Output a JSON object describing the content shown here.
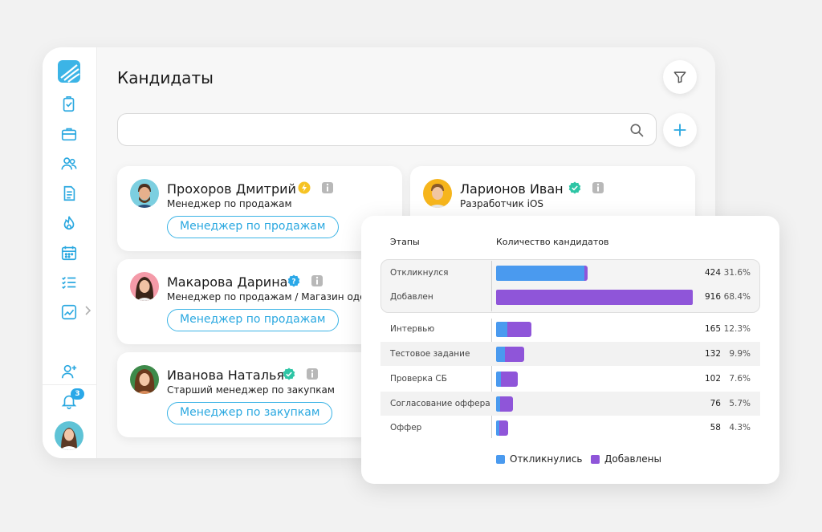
{
  "page": {
    "title": "Кандидаты"
  },
  "search": {
    "value": "",
    "placeholder": ""
  },
  "sidebar": {
    "nav": [
      "logo-icon",
      "tasks-icon",
      "briefcase-icon",
      "users-icon",
      "document-icon",
      "fire-icon",
      "calendar-icon",
      "checklist-icon",
      "chart-icon",
      "add-user-icon",
      "bell-icon"
    ],
    "notifications_count": "3"
  },
  "candidates": [
    {
      "name": "Прохоров Дмитрий",
      "role": "Менеджер по продажам",
      "tag": "Менеджер по продажам",
      "status_icon": "lightning-icon"
    },
    {
      "name": "Ларионов  Иван",
      "role": "Разработчик iOS",
      "tag": "",
      "status_icon": "verified-icon"
    },
    {
      "name": "Макарова Дарина",
      "role": "Менеджер по продажам / Магазин одежд",
      "tag": "Менеджер по продажам",
      "status_icon": "question-icon"
    },
    {
      "name": "Иванова Наталья",
      "role": "Старший менеджер по закупкам",
      "tag": "Менеджер по закупкам",
      "status_icon": "verified-icon"
    }
  ],
  "funnel": {
    "header_stages": "Этапы",
    "header_count": "Количество кандидатов",
    "legend": {
      "responded": "Откликнулись",
      "added": "Добавлены"
    }
  },
  "colors": {
    "accent": "#3cb4e6",
    "responded": "#4a9aef",
    "added": "#8f55d9"
  },
  "chart_data": {
    "type": "bar",
    "categories": [
      "Откликнулся",
      "Добавлен",
      "Интервью",
      "Тестовое задание",
      "Проверка СБ",
      "Согласование оффера",
      "Оффер"
    ],
    "totals": [
      424,
      916,
      165,
      132,
      102,
      76,
      58
    ],
    "percent_labels": [
      "31.6%",
      "68.4%",
      "12.3%",
      "9.9%",
      "7.6%",
      "5.7%",
      "4.3%"
    ],
    "series": [
      {
        "name": "Откликнулись",
        "values": [
          410,
          0,
          52,
          42,
          22,
          18,
          16
        ]
      },
      {
        "name": "Добавлены",
        "values": [
          14,
          916,
          113,
          90,
          80,
          58,
          42
        ]
      }
    ],
    "xlim": [
      0,
      920
    ]
  }
}
